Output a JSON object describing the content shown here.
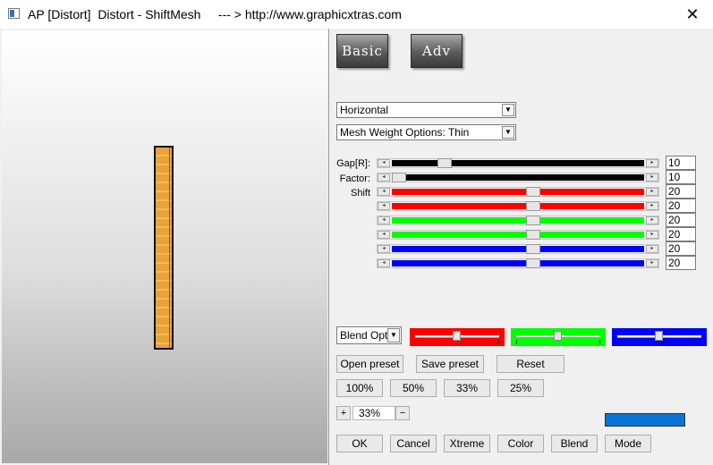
{
  "window": {
    "title": "AP [Distort]  Distort - ShiftMesh     --- > http://www.graphicxtras.com",
    "close_glyph": "✕"
  },
  "top_buttons": {
    "basic": "Basic",
    "adv": "Adv"
  },
  "dropdowns": {
    "direction": "Horizontal",
    "mesh_weight": "Mesh Weight Options: Thin",
    "blend": "Blend Optio",
    "arrow": "▼"
  },
  "sliders": {
    "labels": {
      "gap": "Gap[R]:",
      "factor": "Factor:",
      "shift": "Shift"
    },
    "arrow_left": "◂",
    "arrow_right": "▸",
    "rows": [
      {
        "value": "10",
        "color": "#000000",
        "level": 0.21
      },
      {
        "value": "10",
        "color": "#000000",
        "level": 0.03
      },
      {
        "value": "20",
        "color": "#ff0000",
        "level": 0.56
      },
      {
        "value": "20",
        "color": "#ff0000",
        "level": 0.56
      },
      {
        "value": "20",
        "color": "#00ff00",
        "level": 0.56
      },
      {
        "value": "20",
        "color": "#00ff00",
        "level": 0.56
      },
      {
        "value": "20",
        "color": "#0000ff",
        "level": 0.56
      },
      {
        "value": "20",
        "color": "#0000ff",
        "level": 0.56
      }
    ]
  },
  "blend_colors": [
    {
      "color": "#ff0000",
      "level": 0.5
    },
    {
      "color": "#00ff00",
      "level": 0.5
    },
    {
      "color": "#0000ff",
      "level": 0.5
    }
  ],
  "preset_buttons": {
    "open": "Open preset",
    "save": "Save preset",
    "reset": "Reset"
  },
  "zoom_buttons": [
    "100%",
    "50%",
    "33%",
    "25%"
  ],
  "zoom": {
    "plus": "+",
    "minus": "−",
    "value": "33%"
  },
  "bottom_buttons": [
    "OK",
    "Cancel",
    "Xtreme",
    "Color",
    "Blend",
    "Mode"
  ],
  "accent_color": "#0a74d6"
}
